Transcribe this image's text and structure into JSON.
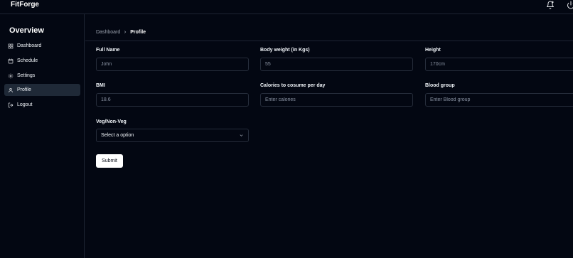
{
  "app": {
    "brand": "FitForge"
  },
  "header": {
    "icons": [
      "bell-plus-icon",
      "power-icon"
    ]
  },
  "sidebar": {
    "title": "Overview",
    "items": [
      {
        "label": "Dashboard",
        "icon": "layout-grid-icon",
        "active": false
      },
      {
        "label": "Schedule",
        "icon": "calendar-icon",
        "active": false
      },
      {
        "label": "Settings",
        "icon": "gear-icon",
        "active": false
      },
      {
        "label": "Profile",
        "icon": "user-icon",
        "active": true
      },
      {
        "label": "Logout",
        "icon": "logout-icon",
        "active": false
      }
    ]
  },
  "breadcrumb": {
    "parent": "Dashboard",
    "current": "Profile"
  },
  "form": {
    "full_name": {
      "label": "Full Name",
      "placeholder": "John"
    },
    "body_weight": {
      "label": "Body weight (in Kgs)",
      "placeholder": "55"
    },
    "height": {
      "label": "Height",
      "placeholder": "170cm"
    },
    "bmi": {
      "label": "BMI",
      "placeholder": "18.6"
    },
    "calories": {
      "label": "Calories to cosume per day",
      "placeholder": "Enter calories"
    },
    "blood_group": {
      "label": "Blood group",
      "placeholder": "Enter Blood group"
    },
    "diet": {
      "label": "Veg/Non-Veg",
      "selected": "Select a option"
    },
    "submit_label": "Submit"
  },
  "colors": {
    "background": "#030712",
    "border": "#1e2433",
    "active_nav": "#1f2937",
    "button": "#ffffff"
  }
}
